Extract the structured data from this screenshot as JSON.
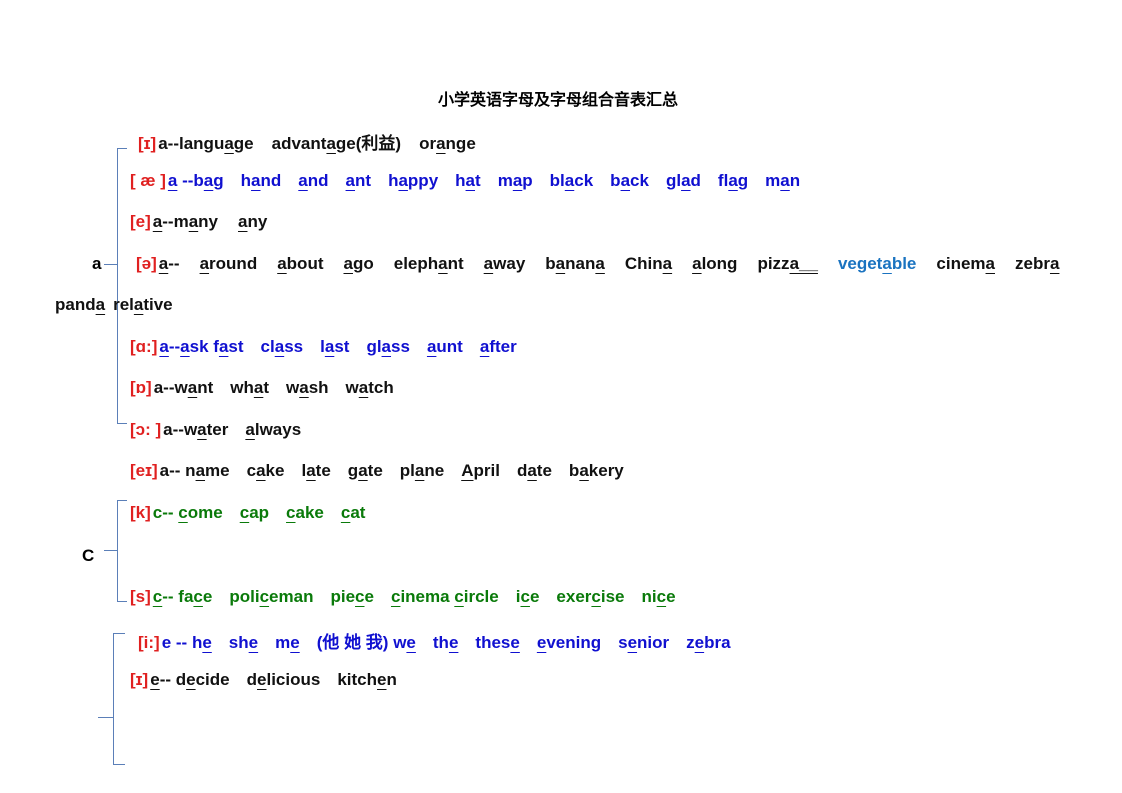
{
  "title": "小学英语字母及字母组合音表汇总",
  "colors": {
    "phonetic": "#e02020",
    "black": "#111111",
    "blue": "#1010d0",
    "green": "#0a7a0a",
    "light_blue": "#1a73c0",
    "brace": "#5b7fb8"
  },
  "labels": {
    "a": "a",
    "c": "C"
  },
  "rows": [
    {
      "phon": "[ɪ]",
      "color": "black",
      "words": [
        [
          "a--langu",
          "a",
          "ge"
        ],
        [
          "advant",
          "a",
          "ge(利益)"
        ],
        [
          "or",
          "a",
          "nge"
        ]
      ]
    },
    {
      "phon": "[ æ ]",
      "color": "blue",
      "words": [
        [
          "",
          "a",
          " --b",
          "a",
          "g"
        ],
        [
          "h",
          "a",
          "nd"
        ],
        [
          "",
          "a",
          "nd"
        ],
        [
          "",
          "a",
          "nt"
        ],
        [
          "h",
          "a",
          "ppy"
        ],
        [
          "h",
          "a",
          "t"
        ],
        [
          "m",
          "a",
          "p"
        ],
        [
          "bl",
          "a",
          "ck"
        ],
        [
          "b",
          "a",
          "ck"
        ],
        [
          "gl",
          "a",
          "d"
        ],
        [
          "fl",
          "a",
          "g"
        ],
        [
          "m",
          "a",
          "n"
        ]
      ]
    },
    {
      "phon": "[e]",
      "color": "black",
      "words": [
        [
          "",
          "a",
          "--m",
          "a",
          "ny"
        ],
        [
          "",
          "a",
          "ny"
        ]
      ]
    },
    {
      "phon": "[ə]",
      "color": "black",
      "words": [
        [
          "",
          "a",
          "-- "
        ],
        [
          "",
          "a",
          "round"
        ],
        [
          "",
          "a",
          "bout"
        ],
        [
          "",
          "a",
          "go"
        ],
        [
          "eleph",
          "a",
          "nt"
        ],
        [
          "",
          "a",
          "way"
        ],
        [
          "b",
          "a",
          "nan",
          "a",
          ""
        ],
        [
          "Chin",
          "a",
          ""
        ],
        [
          "",
          "a",
          "long"
        ],
        [
          "pizz",
          "a__",
          ""
        ],
        [
          "veget",
          "a",
          "ble"
        ],
        [
          "cinem",
          "a",
          ""
        ],
        [
          "zebr",
          "a",
          ""
        ]
      ],
      "special": {
        "10": "light_blue"
      }
    },
    {
      "phon": "",
      "color": "black",
      "words": [
        [
          "pand",
          "a",
          ""
        ],
        [
          "rel",
          "a",
          "tive"
        ]
      ]
    },
    {
      "phon": "[ɑ:]",
      "color": "blue",
      "words": [
        [
          "",
          "a",
          "--",
          "a",
          "sk f",
          "a",
          "st"
        ],
        [
          "cl",
          "a",
          "ss"
        ],
        [
          "l",
          "a",
          "st"
        ],
        [
          "gl",
          "a",
          "ss"
        ],
        [
          "",
          "a",
          "unt"
        ],
        [
          "",
          "a",
          "fter"
        ]
      ]
    },
    {
      "phon": "[ɒ]",
      "color": "black",
      "words": [
        [
          " a--w",
          "a",
          "nt"
        ],
        [
          "wh",
          "a",
          "t"
        ],
        [
          "w",
          "a",
          "sh"
        ],
        [
          "w",
          "a",
          "tch"
        ]
      ]
    },
    {
      "phon": "[ɔ: ]",
      "color": "black",
      "words": [
        [
          "a--w",
          "a",
          "ter"
        ],
        [
          "",
          "a",
          "lways"
        ]
      ]
    },
    {
      "phon": "[eɪ]",
      "color": "black",
      "words": [
        [
          " a-- n",
          "a",
          "me"
        ],
        [
          "c",
          "a",
          "ke"
        ],
        [
          "l",
          "a",
          "te"
        ],
        [
          "g",
          "a",
          "te"
        ],
        [
          "pl",
          "a",
          "ne"
        ],
        [
          "",
          "A",
          "pril"
        ],
        [
          "d",
          "a",
          "te"
        ],
        [
          "b",
          "a",
          "kery"
        ]
      ]
    },
    {
      "phon": "[k]",
      "color": "green",
      "words": [
        [
          "c-- ",
          "c",
          "ome"
        ],
        [
          "",
          "c",
          "ap"
        ],
        [
          "",
          "c",
          "ake"
        ],
        [
          "",
          "c",
          "at"
        ]
      ]
    },
    {
      "phon": "[s]",
      "color": "green",
      "words": [
        [
          "",
          "c",
          "-- fa",
          "c",
          "e"
        ],
        [
          "poli",
          "c",
          "eman"
        ],
        [
          "pie",
          "c",
          "e"
        ],
        [
          "",
          "c",
          "inema ",
          "c",
          "ircle"
        ],
        [
          "i",
          "c",
          "e"
        ],
        [
          "exer",
          "c",
          "ise"
        ],
        [
          "ni",
          "c",
          "e"
        ]
      ]
    },
    {
      "phon": "[i:]",
      "color": "blue",
      "words": [
        [
          "e -- h",
          "e",
          ""
        ],
        [
          "sh",
          "e",
          ""
        ],
        [
          "m",
          "e",
          ""
        ],
        [
          "(他 她 我) w",
          "e",
          ""
        ],
        [
          "th",
          "e",
          ""
        ],
        [
          "thes",
          "e",
          ""
        ],
        [
          "",
          "e",
          "vening"
        ],
        [
          "s",
          "e",
          "nior"
        ],
        [
          "z",
          "e",
          "bra"
        ]
      ]
    },
    {
      "phon": "[ɪ]",
      "color": "black",
      "words": [
        [
          "",
          "e",
          "-- d",
          "e",
          "cide"
        ],
        [
          "d",
          "e",
          "licious"
        ],
        [
          "kitch",
          "e",
          "n"
        ]
      ]
    }
  ]
}
